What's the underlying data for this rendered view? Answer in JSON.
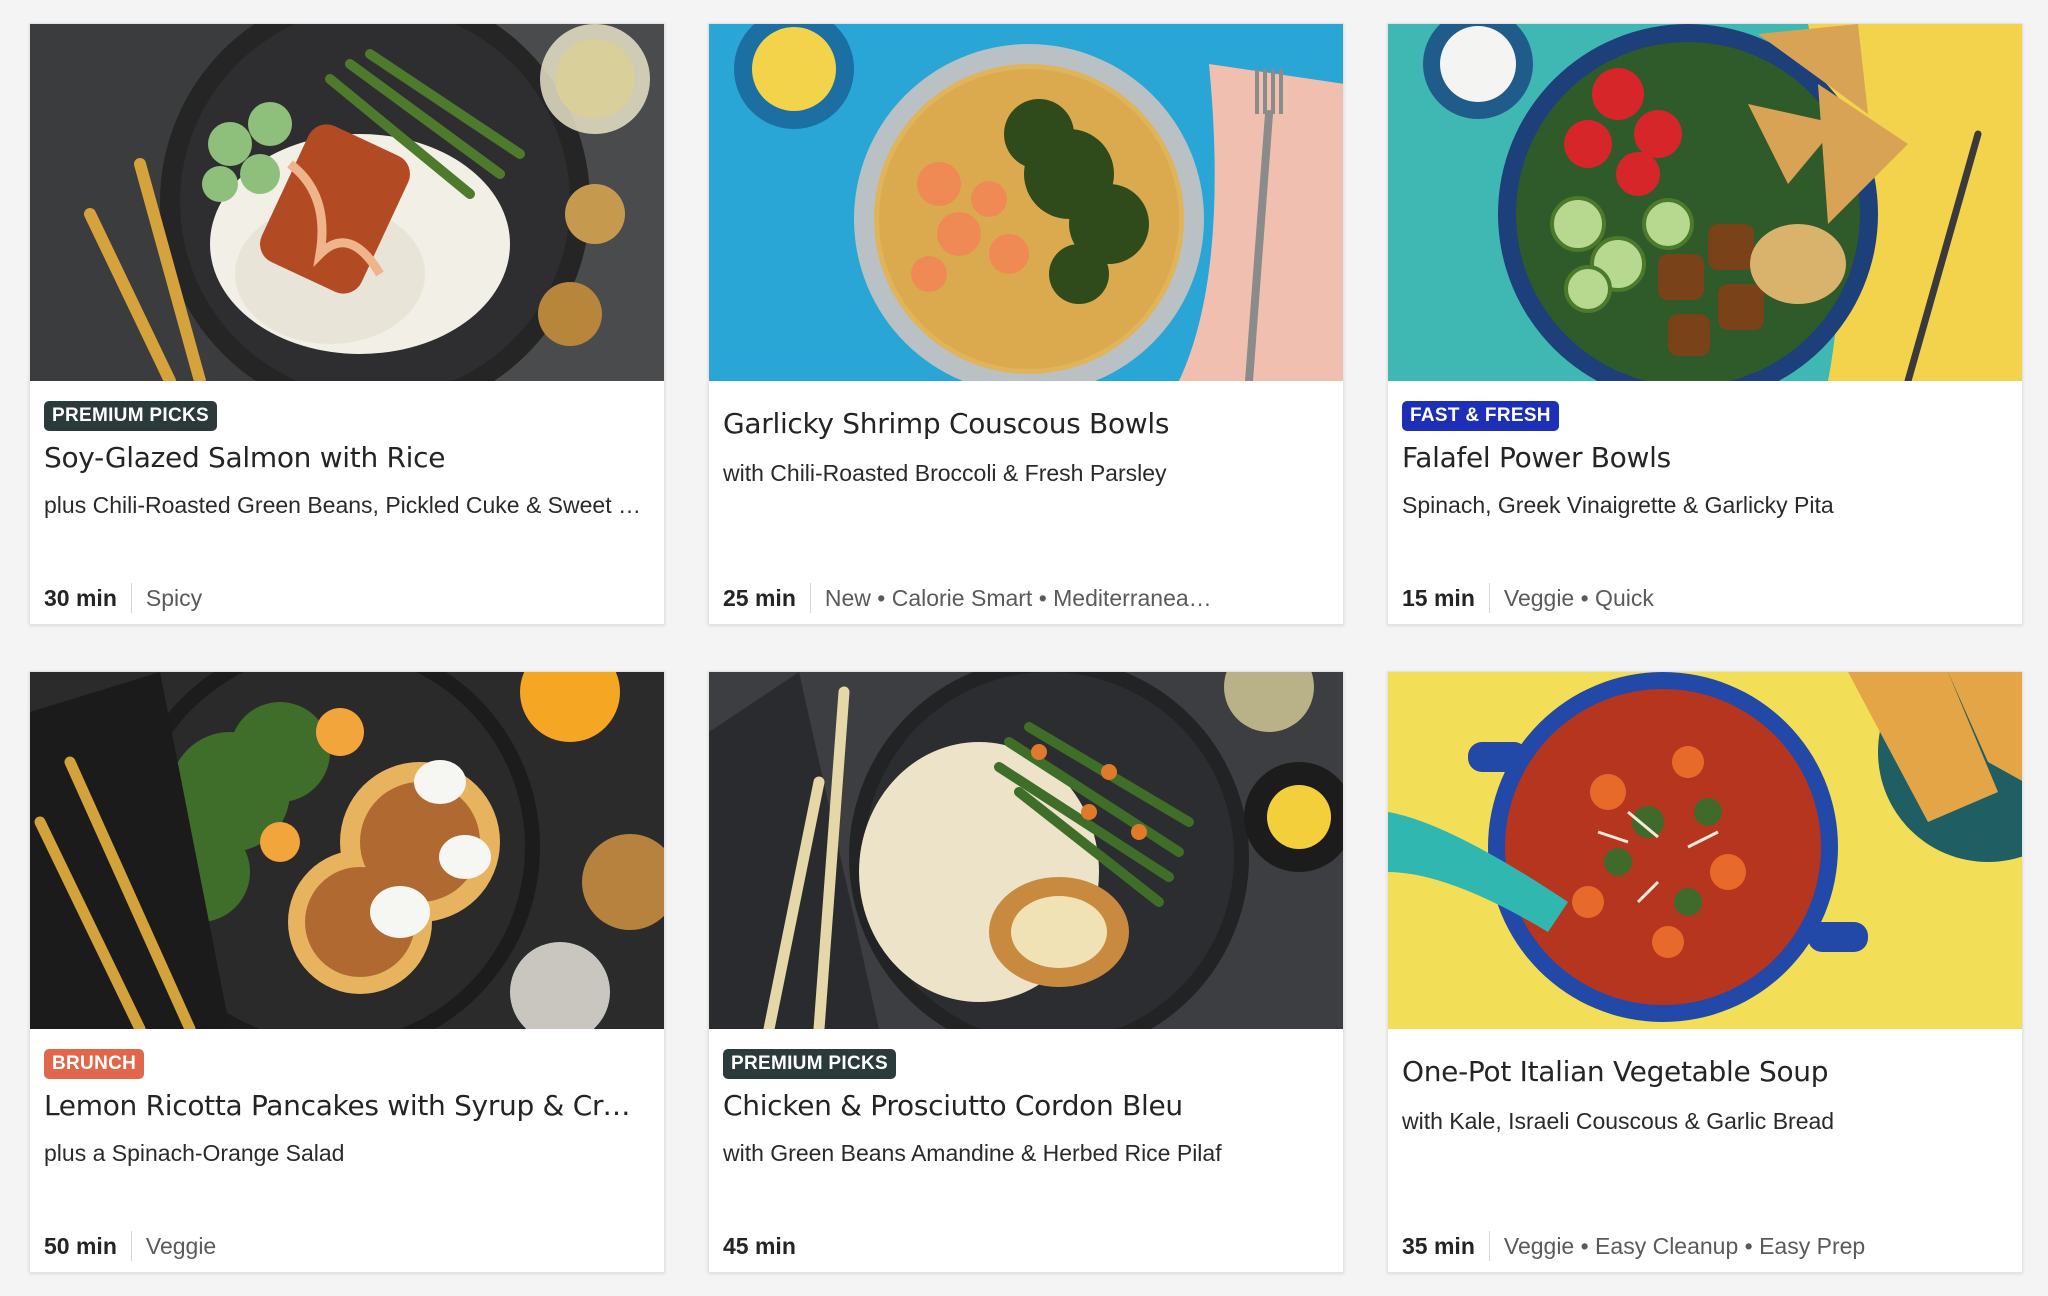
{
  "badge_colors": {
    "premium": "#2b3a3a",
    "fast": "#1c2fb6",
    "brunch": "#e0674b"
  },
  "recipes": [
    {
      "badge": "PREMIUM PICKS",
      "title": "Soy-Glazed Salmon with Rice",
      "subtitle": "plus Chili-Roasted Green Beans, Pickled Cuke & Sweet …",
      "time": "30 min",
      "tags": "Spicy"
    },
    {
      "badge": "",
      "title": "Garlicky Shrimp Couscous Bowls",
      "subtitle": "with Chili-Roasted Broccoli & Fresh Parsley",
      "time": "25 min",
      "tags": "New • Calorie Smart • Mediterranea…"
    },
    {
      "badge": "FAST & FRESH",
      "title": "Falafel Power Bowls",
      "subtitle": "Spinach, Greek Vinaigrette & Garlicky Pita",
      "time": "15 min",
      "tags": "Veggie • Quick"
    },
    {
      "badge": "BRUNCH",
      "title": "Lemon Ricotta Pancakes with Syrup & Crè…",
      "subtitle": "plus a Spinach-Orange Salad",
      "time": "50 min",
      "tags": "Veggie"
    },
    {
      "badge": "PREMIUM PICKS",
      "title": "Chicken & Prosciutto Cordon Bleu",
      "subtitle": "with Green Beans Amandine & Herbed Rice Pilaf",
      "time": "45 min",
      "tags": ""
    },
    {
      "badge": "",
      "title": "One-Pot Italian Vegetable Soup",
      "subtitle": "with Kale, Israeli Couscous & Garlic Bread",
      "time": "35 min",
      "tags": "Veggie • Easy Cleanup • Easy Prep"
    }
  ]
}
